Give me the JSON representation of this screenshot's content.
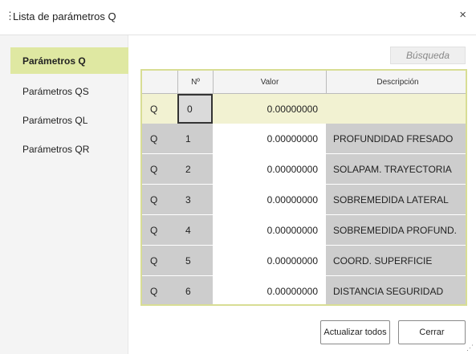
{
  "window": {
    "title": "Lista de parámetros Q",
    "close_glyph": "×"
  },
  "sidebar": {
    "items": [
      {
        "label": "Parámetros Q",
        "active": true
      },
      {
        "label": "Parámetros QS"
      },
      {
        "label": "Parámetros QL"
      },
      {
        "label": "Parámetros QR"
      }
    ]
  },
  "search": {
    "placeholder": "Búsqueda"
  },
  "table": {
    "columns": [
      "",
      "Nº",
      "Valor",
      "Descripción"
    ],
    "rows": [
      {
        "type": "Q",
        "num": "0",
        "value": "0.00000000",
        "desc": ""
      },
      {
        "type": "Q",
        "num": "1",
        "value": "0.00000000",
        "desc": "PROFUNDIDAD FRESADO"
      },
      {
        "type": "Q",
        "num": "2",
        "value": "0.00000000",
        "desc": "SOLAPAM. TRAYECTORIA"
      },
      {
        "type": "Q",
        "num": "3",
        "value": "0.00000000",
        "desc": "SOBREMEDIDA LATERAL"
      },
      {
        "type": "Q",
        "num": "4",
        "value": "0.00000000",
        "desc": "SOBREMEDIDA PROFUND."
      },
      {
        "type": "Q",
        "num": "5",
        "value": "0.00000000",
        "desc": "COORD. SUPERFICIE"
      },
      {
        "type": "Q",
        "num": "6",
        "value": "0.00000000",
        "desc": "DISTANCIA SEGURIDAD"
      }
    ]
  },
  "buttons": {
    "update_all": "Actualizar todos",
    "close": "Cerrar"
  },
  "colors": {
    "accent": "#dfe8a2",
    "row_gray": "#cdcdcd",
    "selected_row": "#f2f2d2",
    "table_border": "#d8dd94"
  }
}
